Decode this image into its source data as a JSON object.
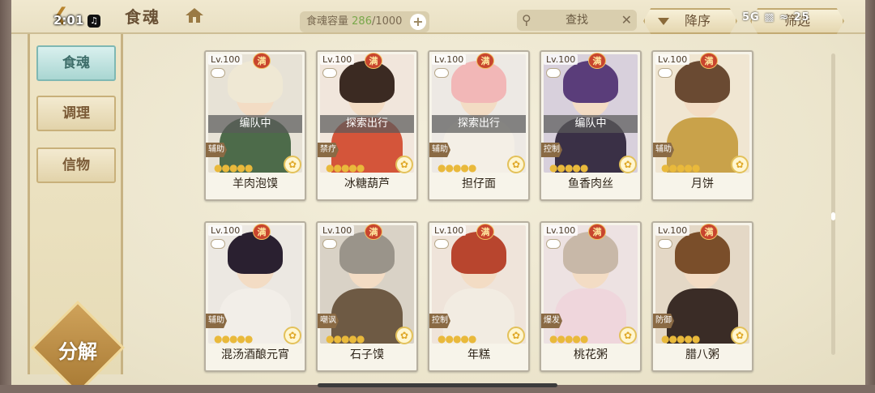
{
  "status": {
    "time": "2:01",
    "network": "5G",
    "battery": "25"
  },
  "header": {
    "title": "食魂",
    "capacity_label": "食魂容量",
    "capacity_current": "286",
    "capacity_max": "/1000",
    "search_placeholder": "查找",
    "sort_label": "降序",
    "filter_label": "筛选"
  },
  "sidebar": {
    "items": [
      {
        "label": "食魂",
        "active": true
      },
      {
        "label": "调理",
        "active": false
      },
      {
        "label": "信物",
        "active": false
      }
    ],
    "decompose_label": "分解"
  },
  "cards": [
    {
      "level": "Lv.100",
      "full": "满",
      "assignment": "编队中",
      "role": "辅助",
      "name": "羊肉泡馍",
      "hair": "#efe8d4",
      "body": "#4d6b4a",
      "bg": "#e7e2d6"
    },
    {
      "level": "Lv.100",
      "full": "满",
      "assignment": "探索出行",
      "role": "禁疗",
      "name": "冰糖葫芦",
      "hair": "#3b2a22",
      "body": "#d4553a",
      "bg": "#f1e6dc"
    },
    {
      "level": "Lv.100",
      "full": "满",
      "assignment": "探索出行",
      "role": "辅助",
      "name": "担仔面",
      "hair": "#f2b7b7",
      "body": "#f4efe6",
      "bg": "#ede9e4"
    },
    {
      "level": "Lv.100",
      "full": "满",
      "assignment": "编队中",
      "role": "控制",
      "name": "鱼香肉丝",
      "hair": "#5a3d7a",
      "body": "#3a3046",
      "bg": "#d8d0dc"
    },
    {
      "level": "Lv.100",
      "full": "满",
      "assignment": "",
      "role": "辅助",
      "name": "月饼",
      "hair": "#6a4a32",
      "body": "#c9a24a",
      "bg": "#f0e6d2"
    },
    {
      "level": "Lv.100",
      "full": "满",
      "assignment": "",
      "role": "辅助",
      "name": "混汤酒酿元宵",
      "hair": "#2a2030",
      "body": "#f2eee8",
      "bg": "#ece8e2"
    },
    {
      "level": "Lv.100",
      "full": "满",
      "assignment": "",
      "role": "嘲讽",
      "name": "石子馍",
      "hair": "#9a948a",
      "body": "#6e5a44",
      "bg": "#d9d2c6"
    },
    {
      "level": "Lv.100",
      "full": "满",
      "assignment": "",
      "role": "控制",
      "name": "年糕",
      "hair": "#b8452e",
      "body": "#f2ece2",
      "bg": "#efe4da"
    },
    {
      "level": "Lv.100",
      "full": "满",
      "assignment": "",
      "role": "爆发",
      "name": "桃花粥",
      "hair": "#c8b8a8",
      "body": "#efd6dc",
      "bg": "#ede2e2"
    },
    {
      "level": "Lv.100",
      "full": "满",
      "assignment": "",
      "role": "防御",
      "name": "腊八粥",
      "hair": "#7a4e2a",
      "body": "#3a2c26",
      "bg": "#e4d8c6"
    }
  ],
  "stars": "●●●●●"
}
